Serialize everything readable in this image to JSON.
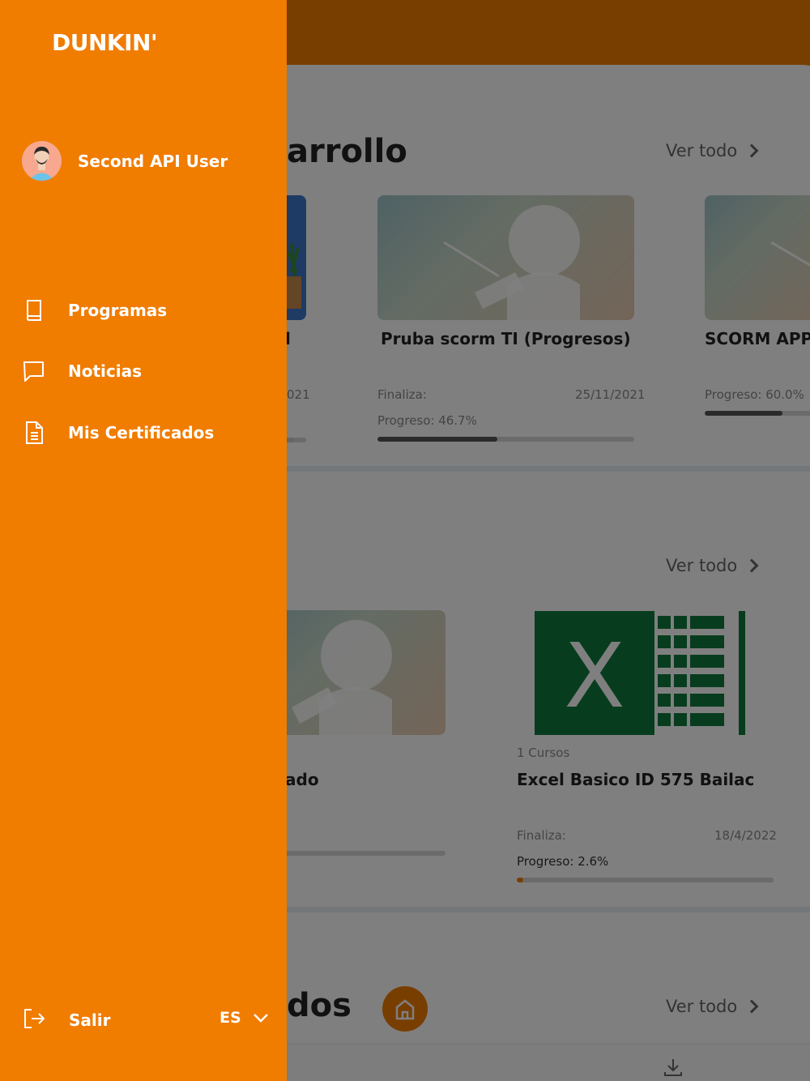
{
  "brand": {
    "logo_text": "DUNKIN'",
    "accent": "#f07c00"
  },
  "drawer": {
    "user_name": "Second API User",
    "items": [
      {
        "label": "Programas",
        "icon": "book-icon"
      },
      {
        "label": "Noticias",
        "icon": "chat-bubble-icon"
      },
      {
        "label": "Mis Certificados",
        "icon": "document-icon"
      }
    ],
    "logout_label": "Salir",
    "language": "ES"
  },
  "main": {
    "sections": [
      {
        "title_visible": "arrollo",
        "see_all": "Ver todo"
      },
      {
        "see_all": "Ver todo"
      },
      {
        "title_visible": "dos",
        "see_all": "Ver todo"
      }
    ],
    "cards_row1": [
      {
        "title_visible": "l",
        "date_visible": "021"
      },
      {
        "title": "Pruba scorm TI (Progresos)",
        "ends_label": "Finaliza:",
        "ends_date": "25/11/2021",
        "progress_text": "Progreso: 46.7%",
        "progress": 0.467
      },
      {
        "title": "SCORM APPs",
        "progress_text": "Progreso: 60.0%",
        "progress": 0.6
      }
    ],
    "cards_row2": [
      {
        "title_visible": "ado"
      },
      {
        "courses": "1 Cursos",
        "title": "Excel Basico ID 575 Bailac",
        "ends_label": "Finaliza:",
        "ends_date": "18/4/2022",
        "progress_text": "Progreso: 2.6%",
        "progress": 0.026
      }
    ]
  }
}
